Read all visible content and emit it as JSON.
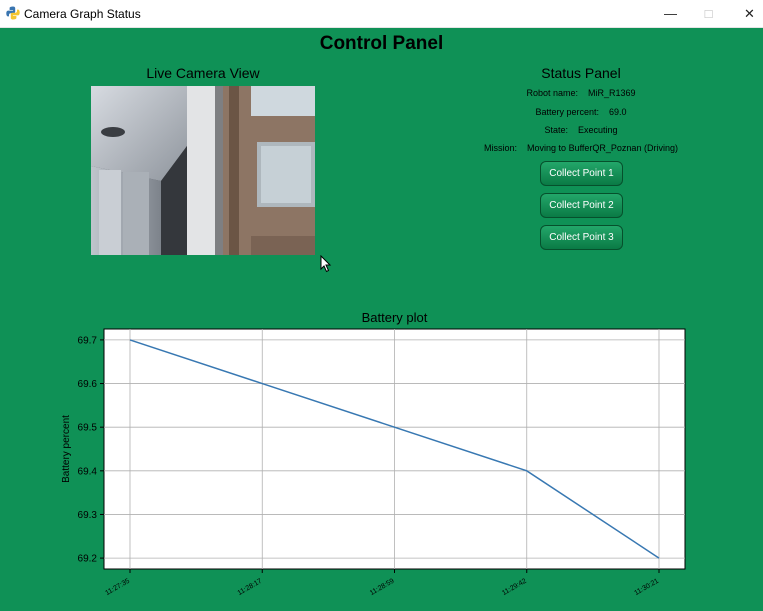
{
  "window": {
    "title": "Camera Graph Status"
  },
  "header": {
    "title": "Control Panel"
  },
  "camera": {
    "label": "Live Camera View"
  },
  "status": {
    "title": "Status Panel",
    "rows": [
      {
        "label": "Robot name:",
        "value": "MiR_R1369"
      },
      {
        "label": "Battery percent:",
        "value": "69.0"
      },
      {
        "label": "State:",
        "value": "Executing"
      },
      {
        "label": "Mission:",
        "value": "Moving to BufferQR_Poznan (Driving)"
      }
    ]
  },
  "buttons": [
    "Collect Point 1",
    "Collect Point 2",
    "Collect Point 3"
  ],
  "chart_data": {
    "type": "line",
    "title": "Battery plot",
    "xlabel": "",
    "ylabel": "Battery percent",
    "x": [
      "11:27:35",
      "11:28:17",
      "11:28:59",
      "11:29:42",
      "11:30:21"
    ],
    "values": [
      69.7,
      69.6,
      69.5,
      69.4,
      69.2
    ],
    "ylim": [
      69.175,
      69.725
    ],
    "yticks": [
      "69.2",
      "69.3",
      "69.4",
      "69.5",
      "69.6",
      "69.7"
    ],
    "grid": true,
    "line_color": "#3878b2"
  }
}
